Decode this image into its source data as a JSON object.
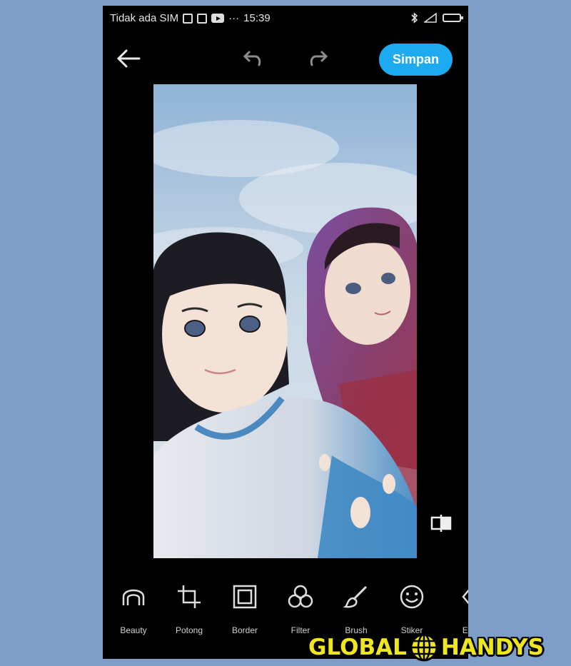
{
  "statusbar": {
    "carrier": "Tidak ada SIM",
    "time": "15:39",
    "dots": "···"
  },
  "topbar": {
    "save_label": "Simpan"
  },
  "tools": [
    {
      "label": "Beauty",
      "icon": "beauty-icon"
    },
    {
      "label": "Potong",
      "icon": "crop-icon"
    },
    {
      "label": "Border",
      "icon": "border-icon"
    },
    {
      "label": "Filter",
      "icon": "filter-icon"
    },
    {
      "label": "Brush",
      "icon": "brush-icon"
    },
    {
      "label": "Stiker",
      "icon": "sticker-icon"
    },
    {
      "label": "Eff",
      "icon": "effect-icon"
    }
  ],
  "watermark": {
    "left": "GLOBAL",
    "right": "HANDYS"
  },
  "colors": {
    "page_bg": "#7f9ec7",
    "accent": "#1eaaf0",
    "logo_yellow": "#f0e61e"
  }
}
